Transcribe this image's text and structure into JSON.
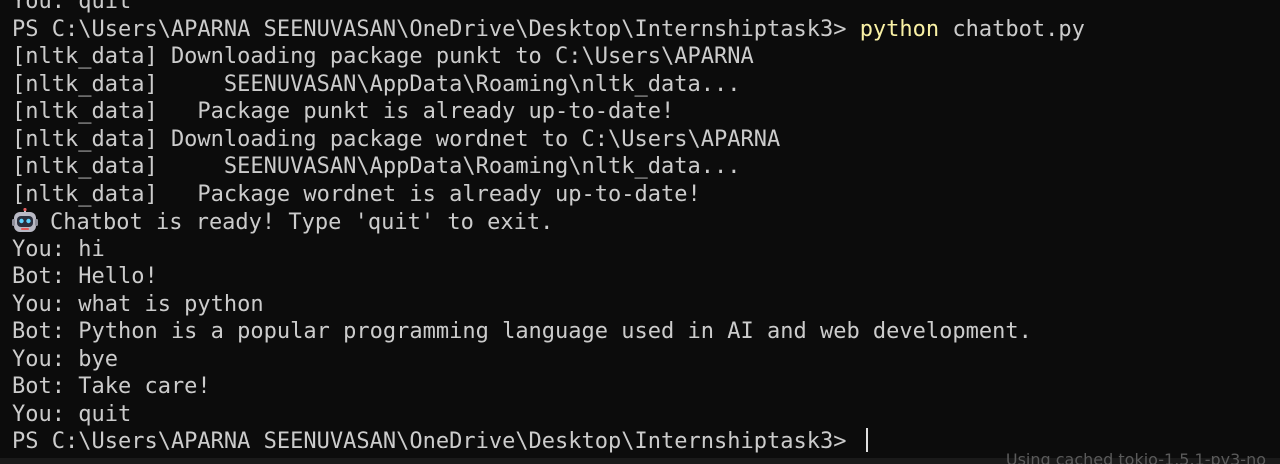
{
  "terminal": {
    "top_clipped_line": "You: quit",
    "prompt_path": "PS C:\\Users\\APARNA SEENUVASAN\\OneDrive\\Desktop\\Internshiptask3> ",
    "command": "python",
    "command_args": " chatbot.py",
    "output": [
      "[nltk_data] Downloading package punkt to C:\\Users\\APARNA",
      "[nltk_data]     SEENUVASAN\\AppData\\Roaming\\nltk_data...",
      "[nltk_data]   Package punkt is already up-to-date!",
      "[nltk_data] Downloading package wordnet to C:\\Users\\APARNA",
      "[nltk_data]     SEENUVASAN\\AppData\\Roaming\\nltk_data...",
      "[nltk_data]   Package wordnet is already up-to-date!"
    ],
    "ready_message": "Chatbot is ready! Type 'quit' to exit.",
    "ready_icon": "robot-face-icon",
    "conversation": [
      "You: hi",
      "Bot: Hello!",
      "You: what is python",
      "Bot: Python is a popular programming language used in AI and web development.",
      "You: bye",
      "Bot: Take care!",
      "You: quit"
    ],
    "final_prompt": "PS C:\\Users\\APARNA SEENUVASAN\\OneDrive\\Desktop\\Internshiptask3> ",
    "bottom_ghost_text": "Using cached tokio-1.5.1-py3-no"
  },
  "colors": {
    "background": "#0c0c0c",
    "text": "#cccccc",
    "command": "#f9f1a5"
  }
}
